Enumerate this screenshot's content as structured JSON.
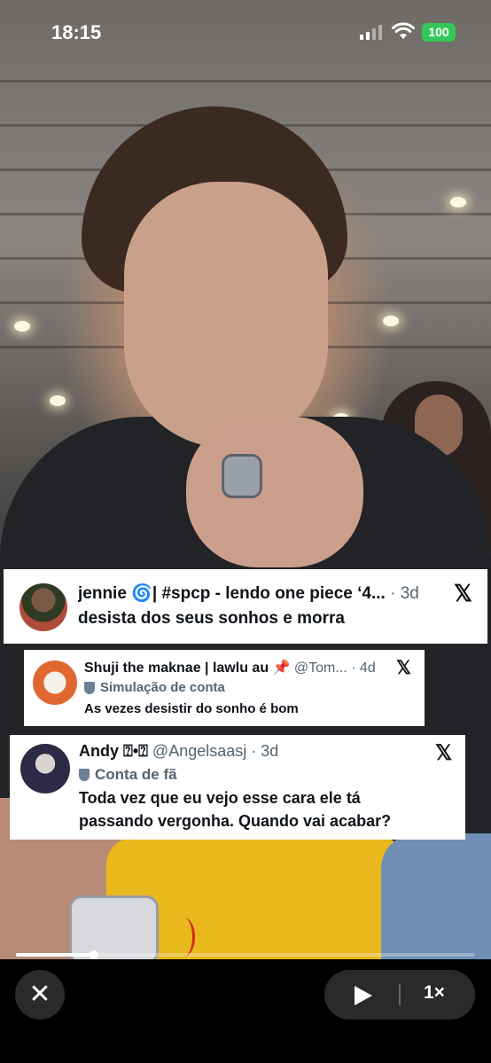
{
  "status_bar": {
    "time": "18:15",
    "battery": "100",
    "battery_color": "#34c759"
  },
  "replies": [
    {
      "name": "jennie ",
      "name_emoji": "🌀",
      "name_rest": "| #spcp - lendo one piece ‘4...",
      "handle": "",
      "age": "· 3d",
      "text": "desista dos seus sonhos e morra"
    },
    {
      "name": "Shuji the maknae | lawlu au ",
      "name_emoji": "📌",
      "handle": " @Tom... ",
      "age": "· 4d",
      "badge": "Simulação de conta",
      "text": "As vezes desistir do sonho é bom"
    },
    {
      "name": "Andy ",
      "name_emoji": "⍰•⍰",
      "handle": " @Angelsaasj ",
      "age": "· 3d",
      "badge": "Conta de fã",
      "text": "Toda vez que eu vejo esse cara ele tá passando vergonha. Quando vai acabar?"
    }
  ],
  "player": {
    "progress": 0.17,
    "speed": "1×",
    "close_icon": "✕"
  }
}
